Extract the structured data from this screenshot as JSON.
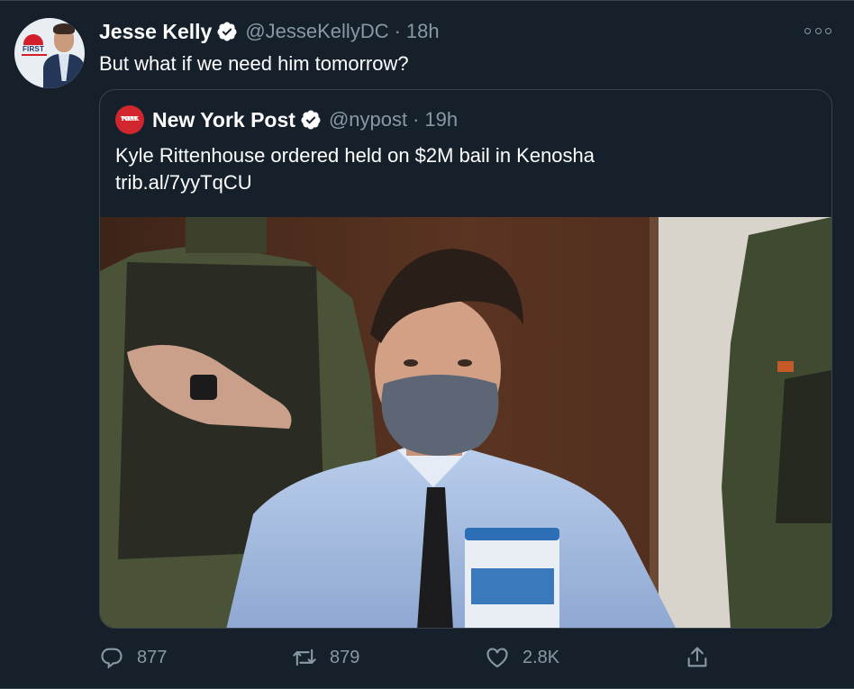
{
  "tweet": {
    "author_name": "Jesse Kelly",
    "author_handle": "@JesseKellyDC",
    "separator": "·",
    "time": "18h",
    "avatar_logo_text": "FIRST",
    "text": "But what if we need him tomorrow?"
  },
  "quote": {
    "author_name": "New York Post",
    "author_handle": "@nypost",
    "separator": "·",
    "time": "19h",
    "avatar_text": [
      "NEW",
      "YORK",
      "POST"
    ],
    "text": "Kyle Rittenhouse ordered held on $2M bail in Kenosha",
    "link": "trib.al/7yyTqCU"
  },
  "actions": {
    "reply_count": "877",
    "retweet_count": "879",
    "like_count": "2.8K"
  },
  "icons": [
    "verified-icon",
    "more-icon",
    "reply-icon",
    "retweet-icon",
    "like-icon",
    "share-icon"
  ],
  "colors": {
    "background": "#15202b",
    "border": "#38444d",
    "secondary_text": "#8899a6",
    "verified": "#ffffff",
    "nypost_red": "#d2262e"
  }
}
